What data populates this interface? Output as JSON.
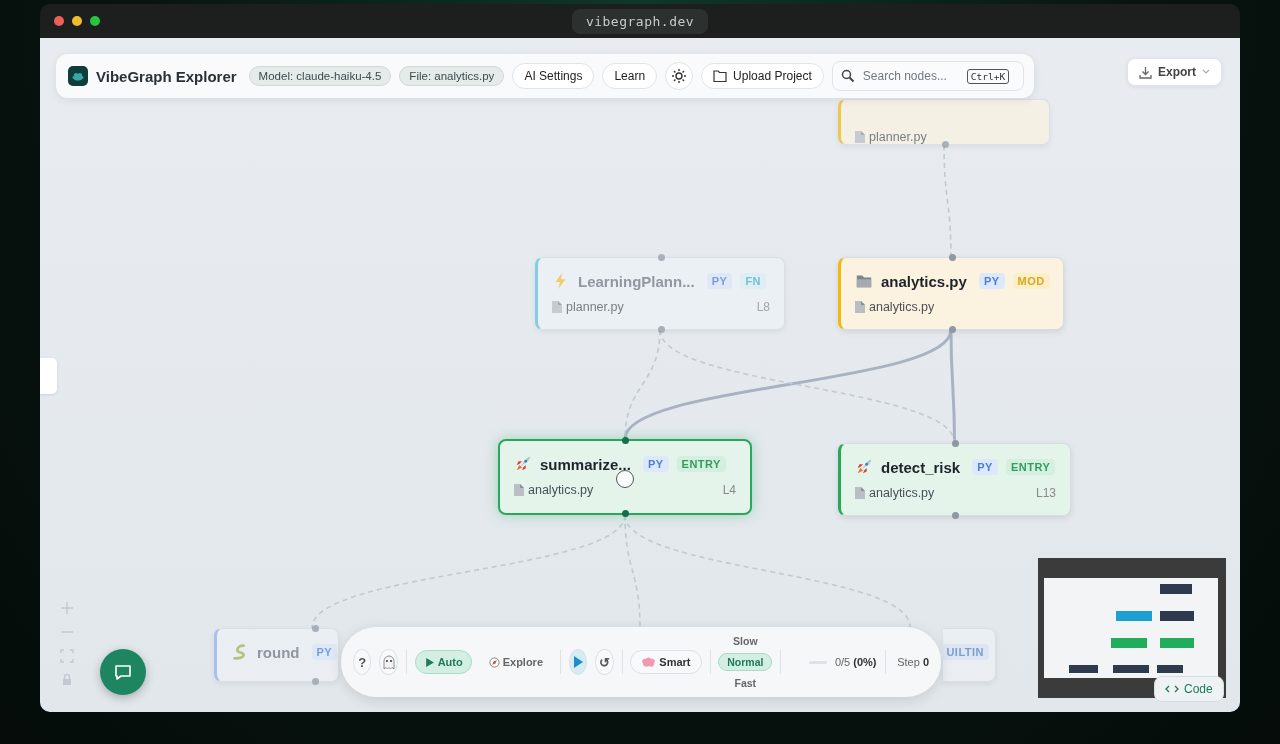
{
  "window": {
    "url": "vibegraph.dev"
  },
  "toolbar": {
    "title": "VibeGraph Explorer",
    "pills": [
      "Model: claude-haiku-4.5",
      "File: analytics.py"
    ],
    "buttons": [
      "AI Settings",
      "Learn"
    ],
    "upload": "Upload Project",
    "search": {
      "placeholder": "Search nodes...",
      "shortcut": "Ctrl+K"
    }
  },
  "export": {
    "label": "Export"
  },
  "nodes": [
    {
      "kind": "module",
      "file": "planner.py",
      "faded": true,
      "selected": false
    },
    {
      "kind": "function",
      "title": "LearningPlann...",
      "badges": [
        {
          "label": "PY",
          "kind": "lang"
        },
        {
          "label": "FN",
          "kind": "function"
        }
      ],
      "file": "planner.py",
      "line": "L8",
      "faded": true,
      "selected": false
    },
    {
      "kind": "module",
      "title": "analytics.py",
      "badges": [
        {
          "label": "PY",
          "kind": "lang"
        },
        {
          "label": "MOD",
          "kind": "module"
        }
      ],
      "file": "analytics.py",
      "faded": false,
      "selected": false
    },
    {
      "kind": "entry",
      "title": "summarize...",
      "badges": [
        {
          "label": "PY",
          "kind": "lang"
        },
        {
          "label": "ENTRY",
          "kind": "entry"
        }
      ],
      "file": "analytics.py",
      "line": "L4",
      "faded": false,
      "selected": true
    },
    {
      "kind": "entry",
      "title": "detect_risk",
      "badges": [
        {
          "label": "PY",
          "kind": "lang"
        },
        {
          "label": "ENTRY",
          "kind": "entry"
        }
      ],
      "file": "analytics.py",
      "line": "L13",
      "faded": false,
      "selected": false
    },
    {
      "kind": "builtin",
      "title": "round",
      "badges": [
        {
          "label": "PY",
          "kind": "lang"
        }
      ],
      "faded": true,
      "selected": false
    },
    {
      "kind": "builtin",
      "badges": [
        {
          "label": "UILTIN",
          "kind": "builtin"
        }
      ],
      "faded": true,
      "selected": false
    }
  ],
  "player": {
    "help": "?",
    "modes": [
      {
        "label": "Auto",
        "selected": true
      },
      {
        "label": "Explore",
        "selected": false
      }
    ],
    "reset": "↺",
    "strategy": "Smart",
    "speeds": [
      {
        "label": "Slow",
        "selected": false
      },
      {
        "label": "Normal",
        "selected": true
      },
      {
        "label": "Fast",
        "selected": false
      }
    ],
    "progress": {
      "level": 0,
      "text": "0/5 **(0%)**"
    },
    "step": "Step **0**"
  },
  "code_button": {
    "label": "Code"
  }
}
